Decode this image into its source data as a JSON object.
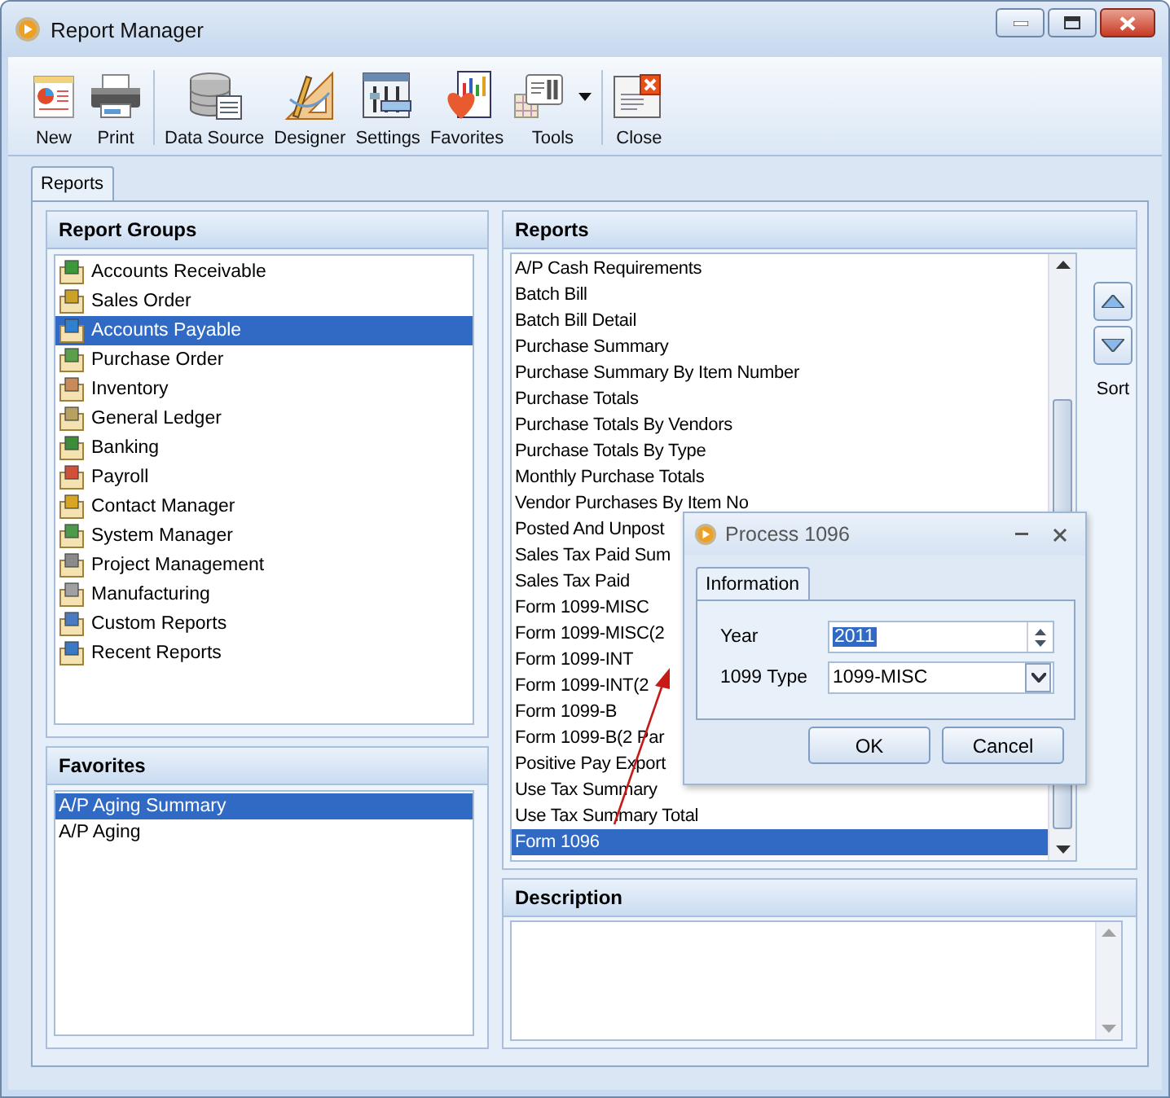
{
  "window": {
    "title": "Report Manager"
  },
  "toolbar_groups": [
    [
      {
        "label": "New",
        "kind": "new"
      },
      {
        "label": "Print",
        "kind": "print"
      }
    ],
    [
      {
        "label": "Data Source",
        "kind": "database"
      },
      {
        "label": "Designer",
        "kind": "designer"
      },
      {
        "label": "Settings",
        "kind": "settings"
      },
      {
        "label": "Favorites",
        "kind": "favorites"
      },
      {
        "label": "Tools",
        "kind": "tools",
        "dropdown": true
      }
    ],
    [
      {
        "label": "Close",
        "kind": "close"
      }
    ]
  ],
  "tabs": [
    {
      "label": "Reports",
      "selected": true
    }
  ],
  "report_groups": {
    "title": "Report Groups",
    "items": [
      {
        "label": "Accounts Receivable",
        "selected": false
      },
      {
        "label": "Sales Order",
        "selected": false
      },
      {
        "label": "Accounts Payable",
        "selected": true
      },
      {
        "label": "Purchase Order",
        "selected": false
      },
      {
        "label": "Inventory",
        "selected": false
      },
      {
        "label": "General Ledger",
        "selected": false
      },
      {
        "label": "Banking",
        "selected": false
      },
      {
        "label": "Payroll",
        "selected": false
      },
      {
        "label": "Contact Manager",
        "selected": false
      },
      {
        "label": "System Manager",
        "selected": false
      },
      {
        "label": "Project Management",
        "selected": false
      },
      {
        "label": "Manufacturing",
        "selected": false
      },
      {
        "label": "Custom Reports",
        "selected": false
      },
      {
        "label": "Recent Reports",
        "selected": false
      }
    ]
  },
  "favorites": {
    "title": "Favorites",
    "items": [
      {
        "label": "A/P Aging Summary",
        "selected": true
      },
      {
        "label": "A/P Aging",
        "selected": false
      }
    ]
  },
  "reports": {
    "title": "Reports",
    "items": [
      {
        "label": "A/P Cash Requirements",
        "selected": false
      },
      {
        "label": "Batch Bill",
        "selected": false
      },
      {
        "label": "Batch Bill Detail",
        "selected": false
      },
      {
        "label": "Purchase Summary",
        "selected": false
      },
      {
        "label": "Purchase Summary By Item Number",
        "selected": false
      },
      {
        "label": "Purchase Totals",
        "selected": false
      },
      {
        "label": "Purchase Totals By Vendors",
        "selected": false
      },
      {
        "label": "Purchase Totals By Type",
        "selected": false
      },
      {
        "label": "Monthly Purchase Totals",
        "selected": false
      },
      {
        "label": "Vendor Purchases By Item No",
        "selected": false
      },
      {
        "label": "Posted And Unpost",
        "selected": false
      },
      {
        "label": "Sales Tax Paid Sum",
        "selected": false
      },
      {
        "label": "Sales Tax Paid",
        "selected": false
      },
      {
        "label": "Form 1099-MISC",
        "selected": false
      },
      {
        "label": "Form 1099-MISC(2",
        "selected": false
      },
      {
        "label": "Form 1099-INT",
        "selected": false
      },
      {
        "label": "Form 1099-INT(2",
        "selected": false
      },
      {
        "label": "Form 1099-B",
        "selected": false
      },
      {
        "label": "Form 1099-B(2 Par",
        "selected": false
      },
      {
        "label": "Positive Pay Export",
        "selected": false
      },
      {
        "label": "Use Tax Summary",
        "selected": false
      },
      {
        "label": "Use Tax Summary Total",
        "selected": false
      },
      {
        "label": "Form 1096",
        "selected": true
      }
    ]
  },
  "sort": {
    "label": "Sort"
  },
  "description": {
    "title": "Description"
  },
  "dialog": {
    "title": "Process 1096",
    "tabs": [
      {
        "label": "Information",
        "selected": true
      }
    ],
    "fields": [
      {
        "label": "Year",
        "value": "2011",
        "kind": "spin",
        "highlighted": true
      },
      {
        "label": "1099 Type",
        "value": "1099-MISC",
        "kind": "select",
        "highlighted": false
      }
    ],
    "buttons": [
      "OK",
      "Cancel"
    ]
  }
}
